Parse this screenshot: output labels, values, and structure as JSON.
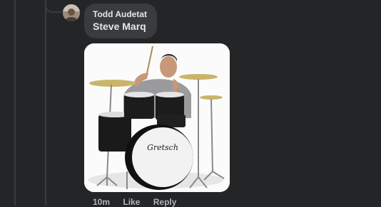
{
  "comment": {
    "author": "Todd Audetat",
    "text": "Steve Marq",
    "avatar_icon": "user-avatar",
    "attachment": {
      "kind": "photo",
      "subject": "drummer-playing-gretsch-drum-kit",
      "bass_drum_logo": "Gretsch"
    },
    "actions": {
      "time": "10m",
      "like_label": "Like",
      "reply_label": "Reply"
    }
  },
  "colors": {
    "background": "#242526",
    "bubble": "#3a3b3c",
    "primary_text": "#e4e6eb",
    "secondary_text": "#b0b3b8"
  }
}
